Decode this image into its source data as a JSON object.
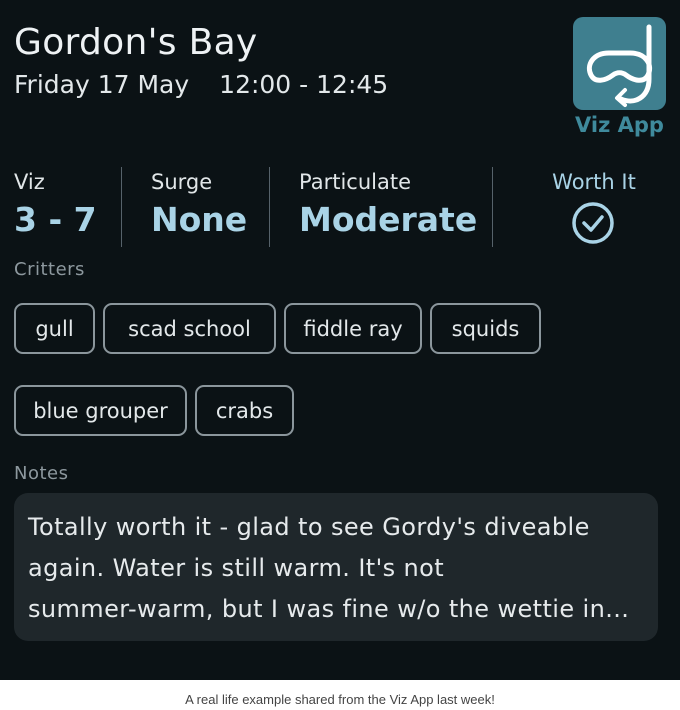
{
  "header": {
    "location": "Gordon's Bay",
    "date": "Friday 17 May",
    "time": "12:00 - 12:45"
  },
  "logo": {
    "label": "Viz App",
    "icon": "snorkel-mask-icon"
  },
  "stats": {
    "viz": {
      "label": "Viz",
      "value": "3 - 7"
    },
    "surge": {
      "label": "Surge",
      "value": "None"
    },
    "particulate": {
      "label": "Particulate",
      "value": "Moderate"
    },
    "worth_it": {
      "label": "Worth It",
      "icon": "check-circle-icon"
    }
  },
  "critters": {
    "label": "Critters",
    "items": [
      "gull",
      "scad school",
      "fiddle ray",
      "squids",
      "blue grouper",
      "crabs"
    ]
  },
  "notes": {
    "label": "Notes",
    "lines": [
      "Totally worth it - glad to see Gordy's diveable",
      "again. Water is still warm. It's not",
      "summer-warm, but I was fine w/o the wettie in..."
    ]
  },
  "caption": "A real life example shared from the Viz App last week!",
  "colors": {
    "background": "#0b1215",
    "accent": "#a9d3e6",
    "logo_bg": "#3f7f8f",
    "notes_bg": "#1f272b"
  }
}
